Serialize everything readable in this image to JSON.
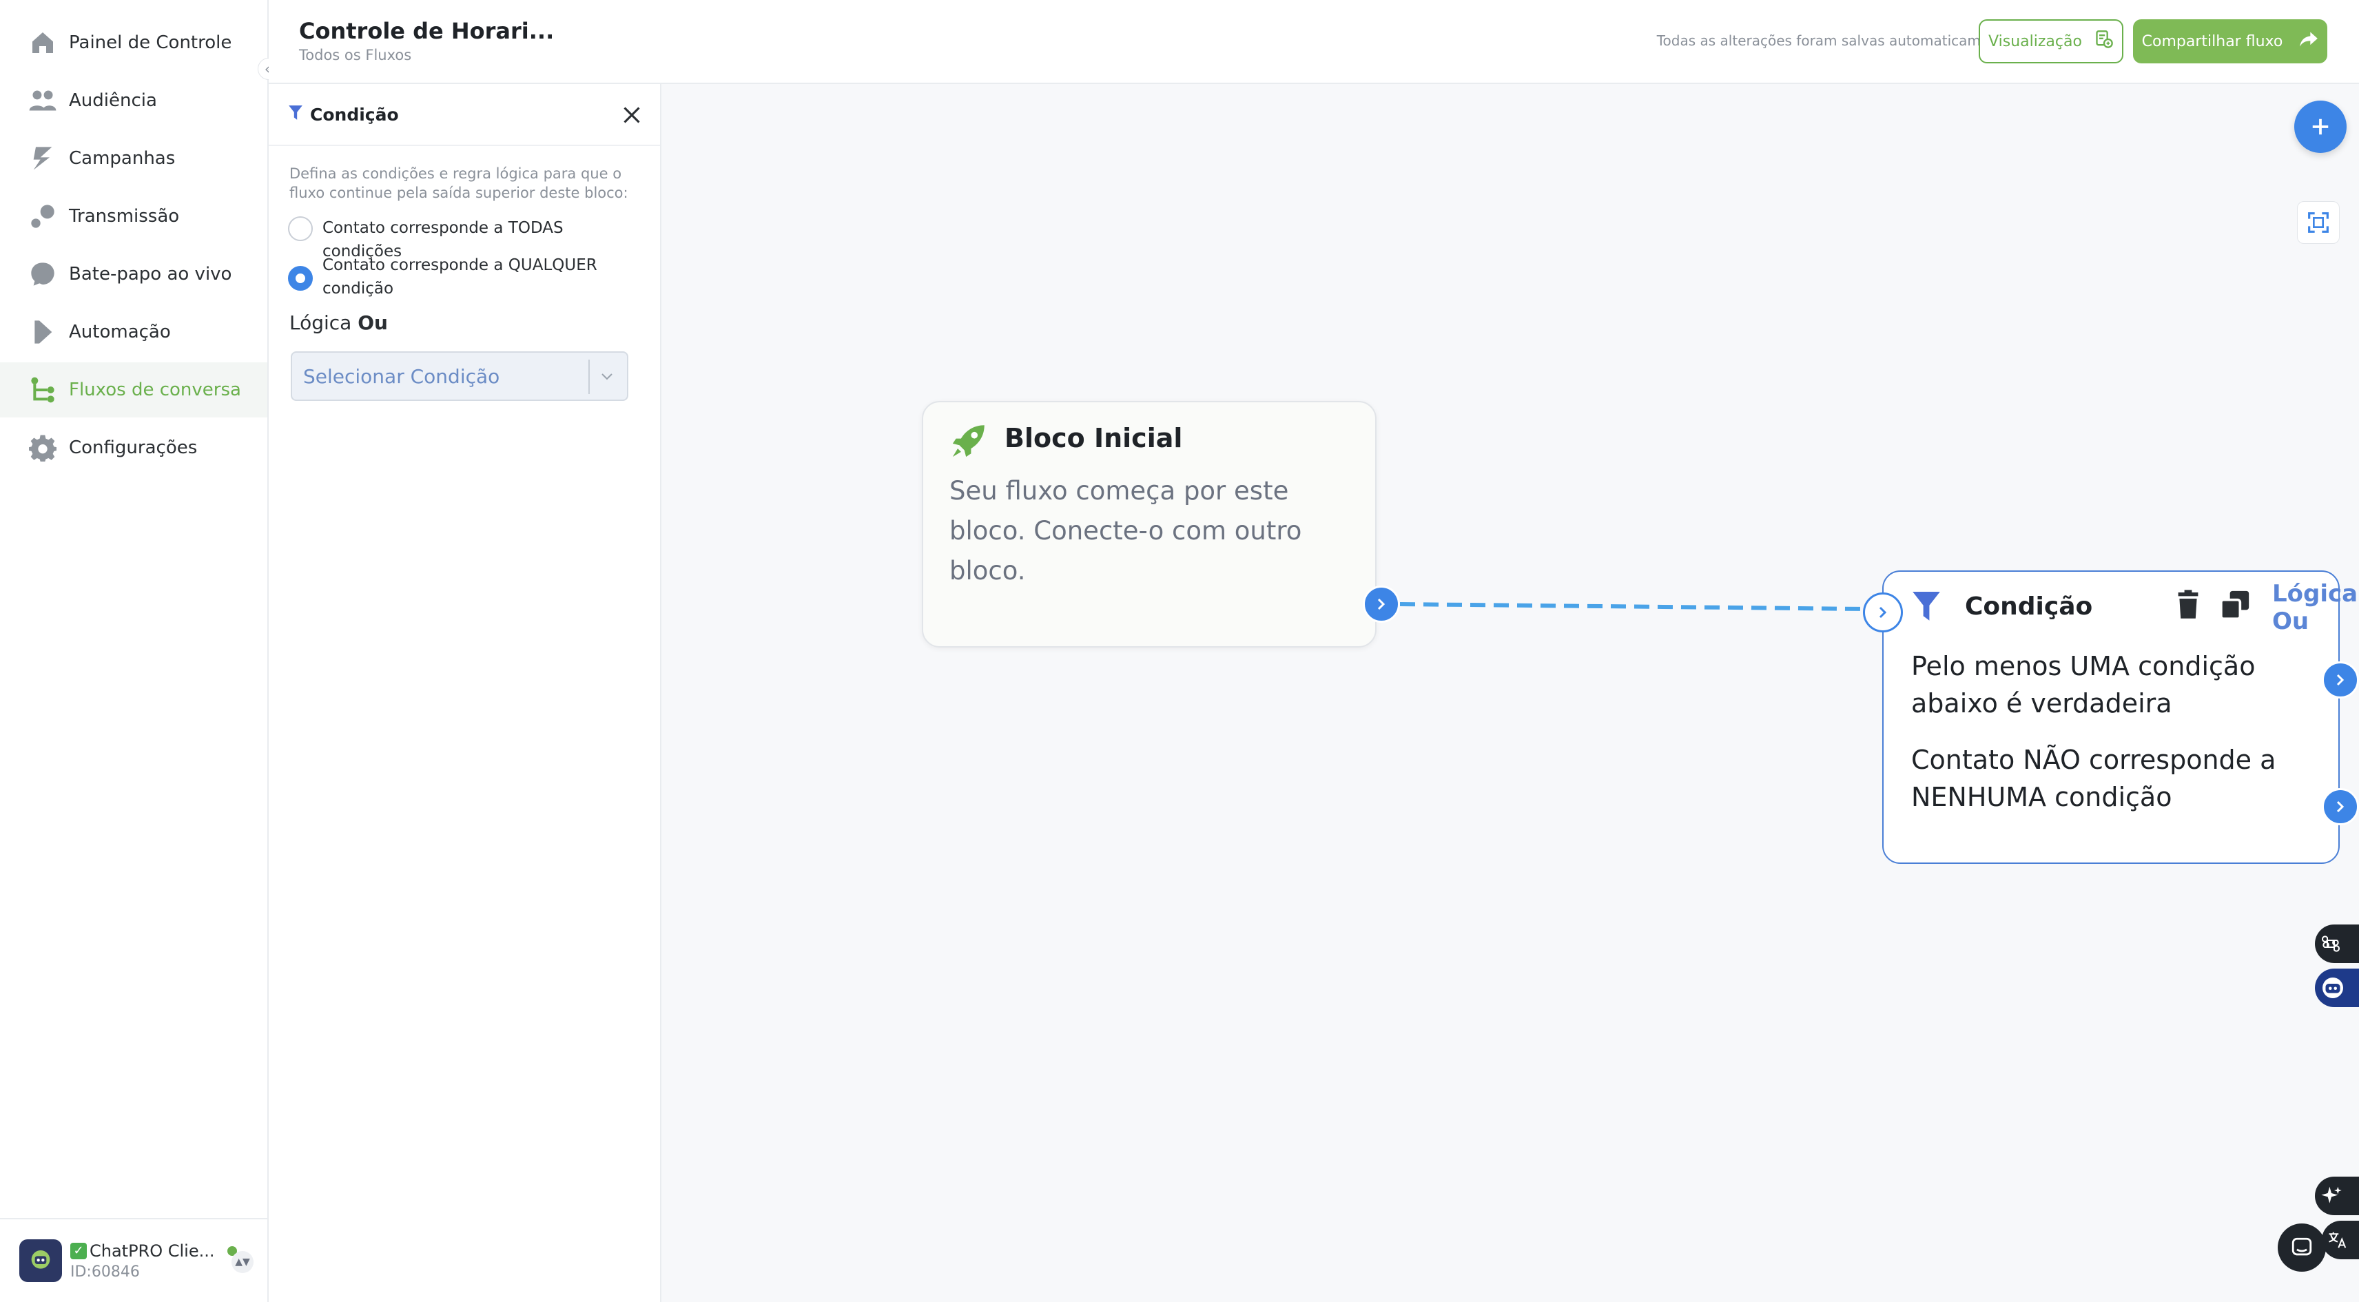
{
  "nav": {
    "items": [
      {
        "label": "Painel de Controle",
        "icon": "home-icon"
      },
      {
        "label": "Audiência",
        "icon": "users-icon"
      },
      {
        "label": "Campanhas",
        "icon": "campaign-icon"
      },
      {
        "label": "Transmissão",
        "icon": "broadcast-icon"
      },
      {
        "label": "Bate-papo ao vivo",
        "icon": "chat-bubble-icon"
      },
      {
        "label": "Automação",
        "icon": "automation-icon"
      },
      {
        "label": "Fluxos de conversa",
        "icon": "flow-icon"
      },
      {
        "label": "Configurações",
        "icon": "gear-icon"
      }
    ],
    "active_index": 6,
    "account": {
      "name": "ChatPRO Clie...",
      "id": "ID:60846"
    }
  },
  "header": {
    "title": "Controle de Horari...",
    "breadcrumb": "Todos os Fluxos",
    "saved_note": "Todas as alterações foram salvas automaticamente",
    "preview_label": "Visualização",
    "share_label": "Compartilhar fluxo"
  },
  "panel": {
    "title": "Condição",
    "description": "Defina as condições e regra lógica para que o fluxo continue pela saída superior deste bloco:",
    "options": [
      {
        "label": "Contato corresponde a TODAS condições",
        "checked": false
      },
      {
        "label": "Contato corresponde a QUALQUER condição",
        "checked": true
      }
    ],
    "logic_label": "Lógica",
    "logic_value": "Ou",
    "select_placeholder": "Selecionar Condição"
  },
  "canvas": {
    "start_node": {
      "title": "Bloco Inicial",
      "body": "Seu fluxo começa por este bloco. Conecte-o com outro bloco."
    },
    "condition_node": {
      "title": "Condição",
      "badge": "Lógica Ou",
      "line1": "Pelo menos UMA condição abaixo é verdadeira",
      "line2": "Contato NÃO corresponde a NENHUMA condição"
    }
  },
  "colors": {
    "brand_green": "#6ab04c",
    "accent_blue": "#3d85e6",
    "canvas_bg": "#f7f8fa"
  }
}
